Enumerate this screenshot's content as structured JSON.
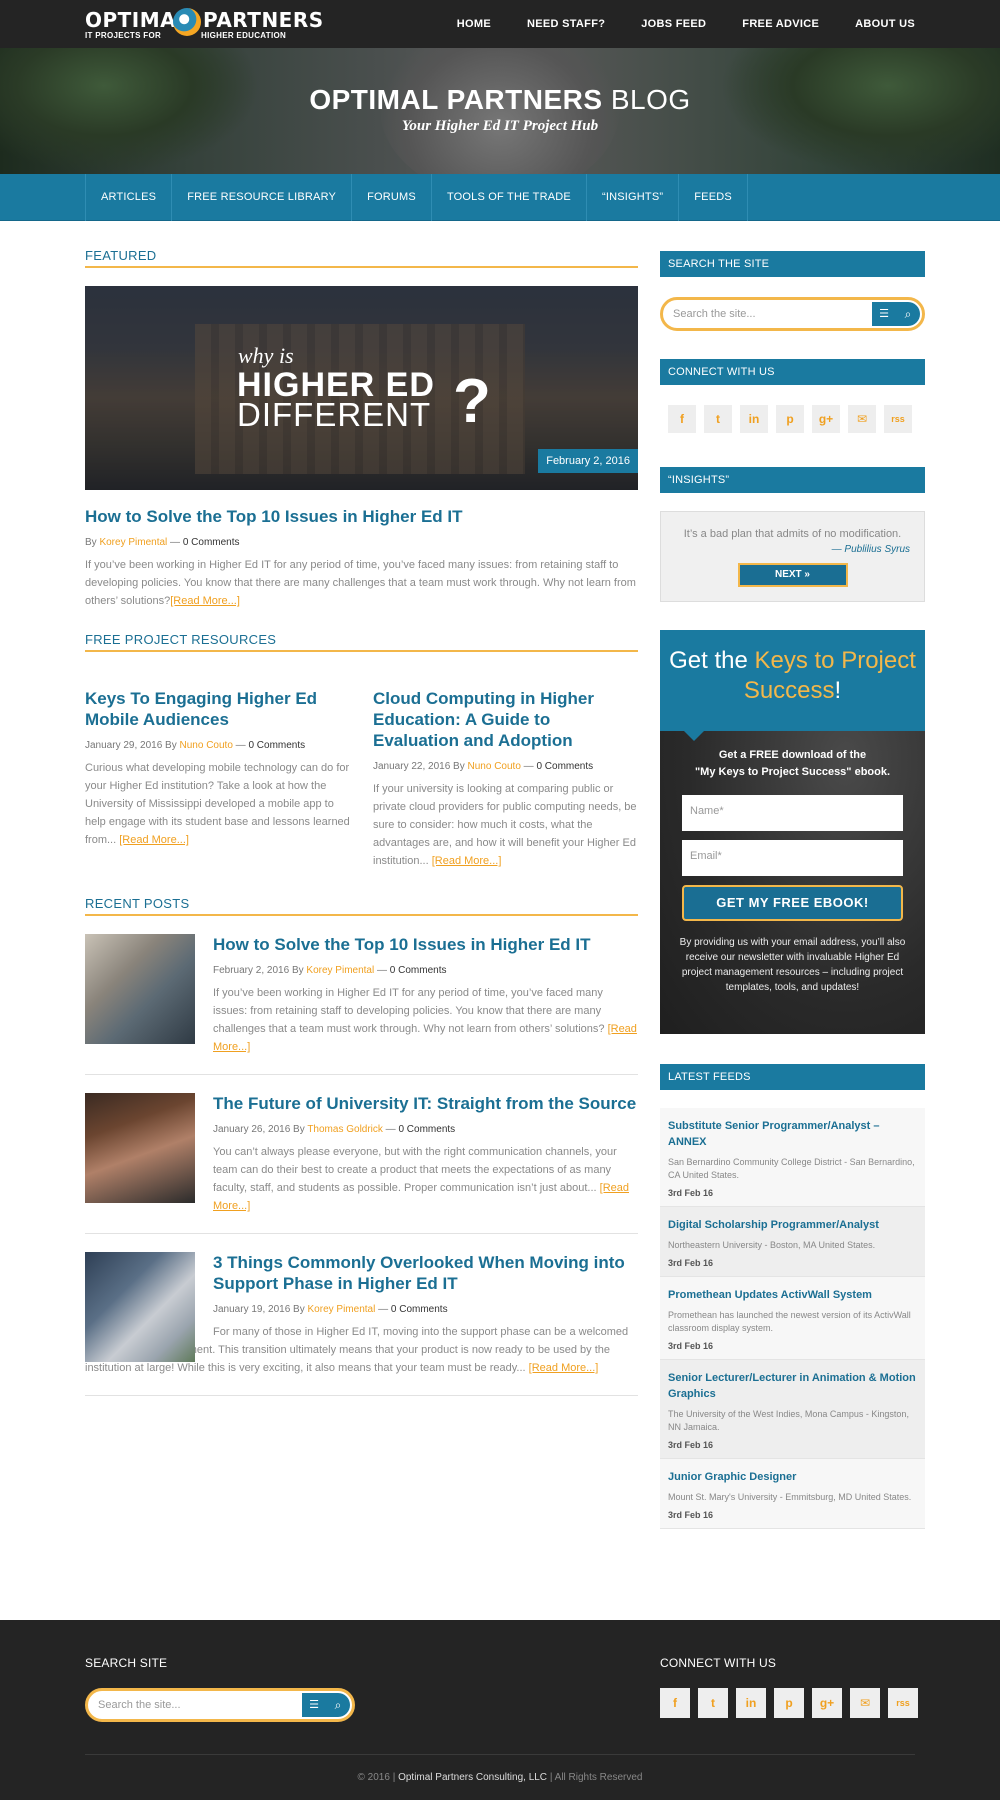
{
  "header": {
    "logo_line1a": "OPTIMAL",
    "logo_line1b": "PARTNERS",
    "logo_line2a": "IT PROJECTS FOR",
    "logo_line2b": "HIGHER EDUCATION",
    "nav": [
      "HOME",
      "NEED STAFF?",
      "JOBS FEED",
      "FREE ADVICE",
      "ABOUT US"
    ]
  },
  "hero": {
    "title_bold": "OPTIMAL PARTNERS",
    "title_light": " BLOG",
    "tagline": "Your Higher Ed IT Project Hub"
  },
  "subnav": [
    "ARTICLES",
    "FREE RESOURCE LIBRARY",
    "FORUMS",
    "TOOLS OF THE TRADE",
    "“INSIGHTS”",
    "FEEDS"
  ],
  "featured": {
    "section": "FEATURED",
    "img_line1": "why is",
    "img_line2": "HIGHER ED",
    "img_line3": "DIFFERENT",
    "img_q": "?",
    "date": "February 2, 2016",
    "title": "How to Solve the Top 10 Issues in Higher Ed IT",
    "by": "By ",
    "author": "Korey Pimental",
    "sep": " — ",
    "comments": "0 Comments",
    "excerpt": "If you’ve been working in Higher Ed IT for any period of time, you’ve faced many issues: from retaining staff to developing policies. You know that there are many challenges that a team must work through. Why not learn from others’ solutions?",
    "readmore": "[Read More...]"
  },
  "resources": {
    "section": "FREE PROJECT RESOURCES",
    "items": [
      {
        "title": "Keys To Engaging Higher Ed Mobile Audiences",
        "date": "January 29, 2016",
        "by": " By ",
        "author": "Nuno Couto",
        "comments": "0 Comments",
        "excerpt": "Curious what developing mobile technology can do for your Higher Ed institution? Take a look at how the University of Mississippi developed a mobile app to help engage with its student base and lessons learned from... ",
        "readmore": "[Read More...]"
      },
      {
        "title": "Cloud Computing in Higher Education: A Guide to Evaluation and Adoption",
        "date": "January 22, 2016",
        "by": " By ",
        "author": "Nuno Couto",
        "comments": "0 Comments",
        "excerpt": "If your university is looking at comparing public or private cloud providers for public computing needs, be sure to consider: how much it costs, what the advantages are, and how it will benefit your Higher Ed institution... ",
        "readmore": "[Read More...]"
      }
    ]
  },
  "recent": {
    "section": "RECENT POSTS",
    "items": [
      {
        "title": "How to Solve the Top 10 Issues in Higher Ed IT",
        "date": "February 2, 2016",
        "by": " By ",
        "author": "Korey Pimental",
        "comments": "0 Comments",
        "excerpt": "If you’ve been working in Higher Ed IT for any period of time, you’ve faced many issues: from retaining staff to developing policies. You know that there are many challenges that a team must work through. Why not learn from others’ solutions? ",
        "readmore": "[Read More...]"
      },
      {
        "title": "The Future of University IT: Straight from the Source",
        "date": "January 26, 2016",
        "by": " By ",
        "author": "Thomas Goldrick",
        "comments": "0 Comments",
        "excerpt": "You can’t always please everyone, but with the right communication channels, your team can do their best to create a product that meets the expectations of as many faculty, staff, and students as possible. Proper communication isn’t just about... ",
        "readmore": "[Read More...]"
      },
      {
        "title": "3 Things Commonly Overlooked When Moving into Support Phase in Higher Ed IT",
        "date": "January 19, 2016",
        "by": " By ",
        "author": "Korey Pimental",
        "comments": "0 Comments",
        "excerpt": "For many of those in Higher Ed IT, moving into the support phase can be a welcomed change from development. This transition ultimately means that your product is now ready to be used by the institution at large! While this is very exciting, it also means that your team must be ready... ",
        "readmore": "[Read More...]"
      }
    ]
  },
  "sidebar": {
    "search_title": "SEARCH THE SITE",
    "search_placeholder": "Search the site...",
    "connect_title": "CONNECT WITH US",
    "social": [
      "f",
      "t",
      "in",
      "p",
      "g+",
      "✉",
      "rss"
    ],
    "insights_title": "“INSIGHTS”",
    "quote": "It’s a bad plan that admits of no modification.",
    "quote_author": "— Publilius Syrus",
    "next": "NEXT »",
    "promo_a": "Get the ",
    "promo_b": "Keys to Project Success",
    "promo_c": "!",
    "promo_text1": "Get a FREE download of the",
    "promo_text2": "\"My Keys to Project Success\" ebook.",
    "name_ph": "Name*",
    "email_ph": "Email*",
    "promo_btn": "GET MY FREE EBOOK!",
    "promo_small": "By providing us with your email address, you’ll also receive our newsletter with invaluable Higher Ed project management resources – including project templates, tools, and updates!",
    "feeds_title": "LATEST FEEDS",
    "feeds": [
      {
        "t": "Substitute Senior Programmer/Analyst – ANNEX",
        "d": "San Bernardino Community College District - San Bernardino, CA United States.",
        "dt": "3rd Feb 16"
      },
      {
        "t": "Digital Scholarship Programmer/Analyst",
        "d": "Northeastern University - Boston, MA United States.",
        "dt": "3rd Feb 16"
      },
      {
        "t": "Promethean Updates ActivWall System",
        "d": "Promethean has launched the newest version of its ActivWall classroom display system.",
        "dt": "3rd Feb 16"
      },
      {
        "t": "Senior Lecturer/Lecturer in Animation & Motion Graphics",
        "d": "The University of the West Indies, Mona Campus - Kingston, NN Jamaica.",
        "dt": "3rd Feb 16"
      },
      {
        "t": "Junior Graphic Designer",
        "d": "Mount St. Mary's University - Emmitsburg, MD United States.",
        "dt": "3rd Feb 16"
      }
    ]
  },
  "footer": {
    "search_title": "SEARCH SITE",
    "search_placeholder": "Search the site...",
    "connect_title": "CONNECT WITH US",
    "copy_a": "© 2016 | ",
    "copy_b": "Optimal Partners Consulting, LLC",
    "copy_c": " | All Rights Reserved"
  },
  "colors": {
    "brand_blue": "#1a7aa0",
    "accent_orange": "#f3b74a",
    "dark": "#242424"
  }
}
